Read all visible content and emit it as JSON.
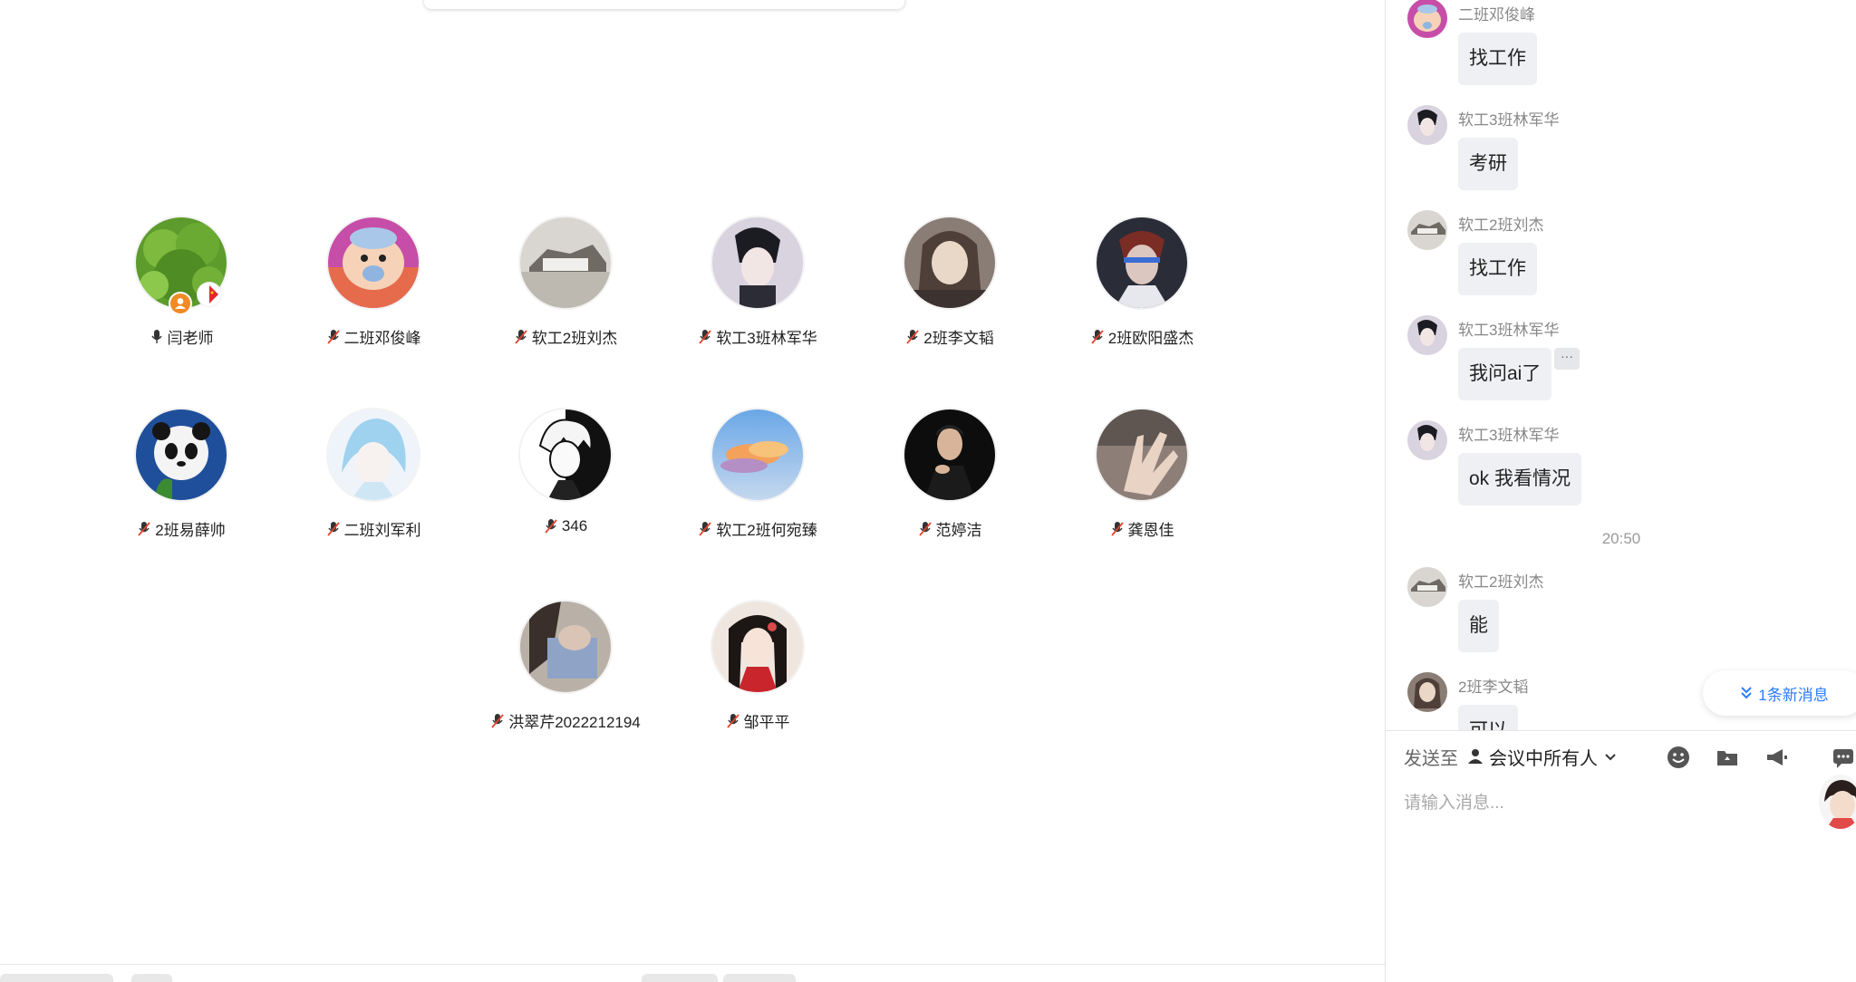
{
  "participants": [
    {
      "name": "闫老师",
      "mic": "on"
    },
    {
      "name": "二班邓俊峰",
      "mic": "muted"
    },
    {
      "name": "软工2班刘杰",
      "mic": "muted"
    },
    {
      "name": "软工3班林军华",
      "mic": "muted"
    },
    {
      "name": "2班李文韬",
      "mic": "muted"
    },
    {
      "name": "2班欧阳盛杰",
      "mic": "muted"
    },
    {
      "name": "2班易薛帅",
      "mic": "muted"
    },
    {
      "name": "二班刘军利",
      "mic": "muted"
    },
    {
      "name": "346",
      "mic": "muted"
    },
    {
      "name": "软工2班何宛臻",
      "mic": "muted"
    },
    {
      "name": "范婷洁",
      "mic": "muted"
    },
    {
      "name": "龚恩佳",
      "mic": "muted"
    },
    {
      "name": "洪翠芹2022212194",
      "mic": "muted"
    },
    {
      "name": "邹平平",
      "mic": "muted"
    }
  ],
  "chat": {
    "messages": [
      {
        "sender": "二班邓俊峰",
        "text": "找工作"
      },
      {
        "sender": "软工3班林军华",
        "text": "考研"
      },
      {
        "sender": "软工2班刘杰",
        "text": "找工作"
      },
      {
        "sender": "软工3班林军华",
        "text": "我问ai了"
      },
      {
        "sender": "软工3班林军华",
        "text": "ok 我看情况"
      },
      {
        "sender": "软工2班刘杰",
        "text": "能"
      },
      {
        "sender": "2班李文韬",
        "text": "可以"
      }
    ],
    "time_divider": "20:50",
    "more_glyph": "···",
    "new_message_indicator": "1条新消息",
    "new_message_icon": "double-chevron-down-icon",
    "composer": {
      "send_to_label": "发送至",
      "recipient": "会议中所有人",
      "placeholder": "请输入消息...",
      "tools": [
        "emoji-icon",
        "folder-icon",
        "megaphone-icon",
        "chat-settings-icon"
      ]
    }
  },
  "colors": {
    "accent": "#2b7cff",
    "muted_mic": "#e0452f",
    "bubble_bg": "#eef0f3",
    "host_badge": "#f08a24"
  }
}
